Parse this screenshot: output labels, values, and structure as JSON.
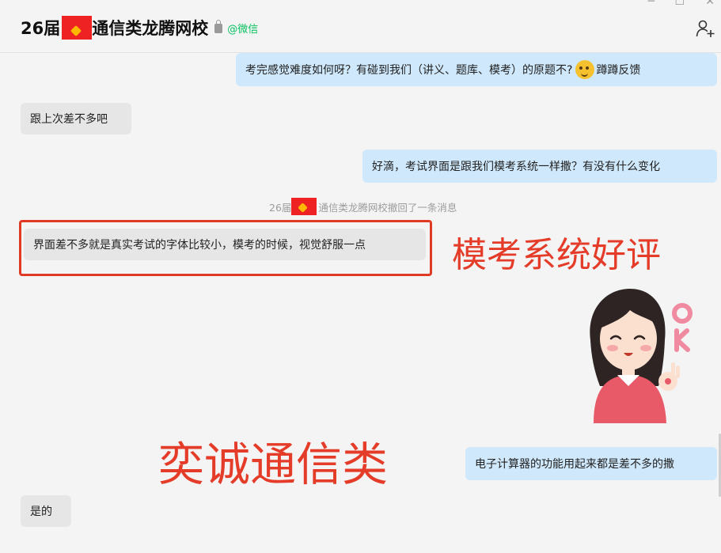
{
  "header": {
    "title_prefix": "26届",
    "title_suffix": "通信类龙腾网校",
    "platform_tag": "@微信",
    "add_icon": "add-user-icon",
    "lock_icon": "lock-icon"
  },
  "messages": [
    {
      "side": "me",
      "text": "考完感觉难度如何呀？有碰到我们（讲义、题库、模考）的原题不?",
      "emoji_text": "蹲蹲反馈"
    },
    {
      "side": "other",
      "text": "跟上次差不多吧"
    },
    {
      "side": "me",
      "text": "好滴，考试界面是跟我们模考系统一样撒？有没有什么变化"
    },
    {
      "side": "system",
      "prefix": "26届",
      "suffix": "通信类龙腾网校撤回了一条消息"
    },
    {
      "side": "other",
      "text": "界面差不多就是真实考试的字体比较小，模考的时候，视觉舒服一点"
    },
    {
      "side": "me",
      "text": "电子计算器的功能用起来都是差不多的撒"
    },
    {
      "side": "other",
      "text": "是的"
    }
  ],
  "annotations": {
    "headline_right": "模考系统好评",
    "headline_bottom": "奕诚通信类",
    "sticker_text": "OK"
  },
  "colors": {
    "annotation_red": "#e43c28",
    "my_bubble": "#cfe8fb",
    "other_bubble": "#e6e6e6",
    "wechat_green": "#07c160"
  }
}
